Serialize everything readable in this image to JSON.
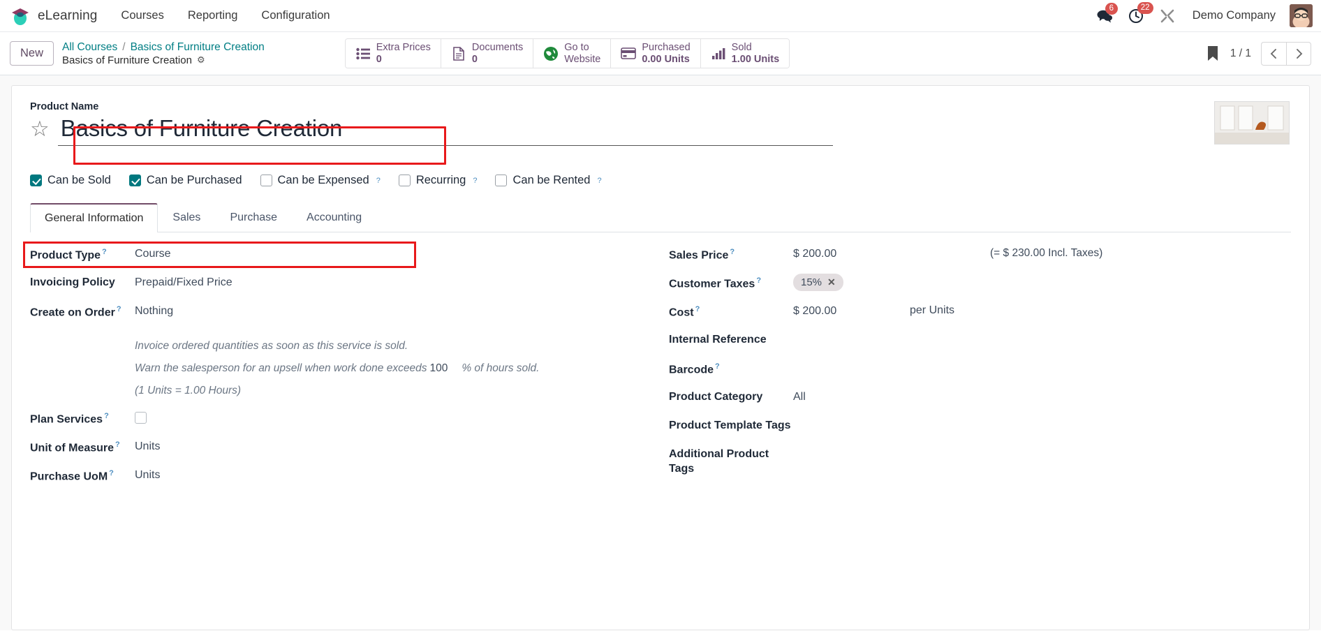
{
  "navbar": {
    "brand": "eLearning",
    "menu": [
      {
        "label": "Courses"
      },
      {
        "label": "Reporting"
      },
      {
        "label": "Configuration"
      }
    ],
    "messages_badge": "6",
    "activities_badge": "22",
    "company": "Demo Company"
  },
  "control_panel": {
    "new_label": "New",
    "breadcrumb_root": "All Courses",
    "breadcrumb_sep": "/",
    "breadcrumb_current": "Basics of Furniture Creation",
    "record_subtitle": "Basics of Furniture Creation",
    "stat_buttons": [
      {
        "label": "Extra Prices",
        "value": "0",
        "icon": "list-icon"
      },
      {
        "label": "Documents",
        "value": "0",
        "icon": "document-icon"
      },
      {
        "label": "Go to",
        "value": "Website",
        "icon": "globe-icon"
      },
      {
        "label": "Purchased",
        "value": "0.00 Units",
        "icon": "card-icon"
      },
      {
        "label": "Sold",
        "value": "1.00 Units",
        "icon": "bar-chart-icon"
      }
    ],
    "pager": "1 / 1"
  },
  "form": {
    "product_name_label": "Product Name",
    "product_name_value": "Basics of Furniture Creation",
    "checkboxes": [
      {
        "label": "Can be Sold",
        "checked": true,
        "help": false
      },
      {
        "label": "Can be Purchased",
        "checked": true,
        "help": false
      },
      {
        "label": "Can be Expensed",
        "checked": false,
        "help": true
      },
      {
        "label": "Recurring",
        "checked": false,
        "help": true
      },
      {
        "label": "Can be Rented",
        "checked": false,
        "help": true
      }
    ],
    "tabs": [
      {
        "label": "General Information",
        "active": true
      },
      {
        "label": "Sales",
        "active": false
      },
      {
        "label": "Purchase",
        "active": false
      },
      {
        "label": "Accounting",
        "active": false
      }
    ],
    "left_fields": {
      "product_type_label": "Product Type",
      "product_type_value": "Course",
      "invoicing_policy_label": "Invoicing Policy",
      "invoicing_policy_value": "Prepaid/Fixed Price",
      "create_on_order_label": "Create on Order",
      "create_on_order_value": "Nothing",
      "helper_invoice": "Invoice ordered quantities as soon as this service is sold.",
      "upsell_prefix": "Warn the salesperson for an upsell when work done exceeds",
      "upsell_value": "100",
      "upsell_suffix": "% of hours sold.",
      "units_equiv": "(1 Units = 1.00 Hours)",
      "plan_services_label": "Plan Services",
      "unit_of_measure_label": "Unit of Measure",
      "unit_of_measure_value": "Units",
      "purchase_uom_label": "Purchase UoM",
      "purchase_uom_value": "Units"
    },
    "right_fields": {
      "sales_price_label": "Sales Price",
      "sales_price_value": "$ 200.00",
      "sales_price_incl": "(= $ 230.00 Incl. Taxes)",
      "customer_taxes_label": "Customer Taxes",
      "customer_taxes_chip": "15%",
      "cost_label": "Cost",
      "cost_value": "$ 200.00",
      "cost_uom": "per Units",
      "internal_reference_label": "Internal Reference",
      "internal_reference_value": "",
      "barcode_label": "Barcode",
      "barcode_value": "",
      "product_category_label": "Product Category",
      "product_category_value": "All",
      "product_template_tags_label": "Product Template Tags",
      "product_template_tags_value": "",
      "additional_product_tags_label": "Additional Product Tags",
      "additional_product_tags_value": ""
    }
  },
  "colors": {
    "accent": "#714b67",
    "link": "#017e84",
    "highlight": "#e8191b",
    "badge": "#d9534f",
    "checkbox_on": "#00787f"
  }
}
